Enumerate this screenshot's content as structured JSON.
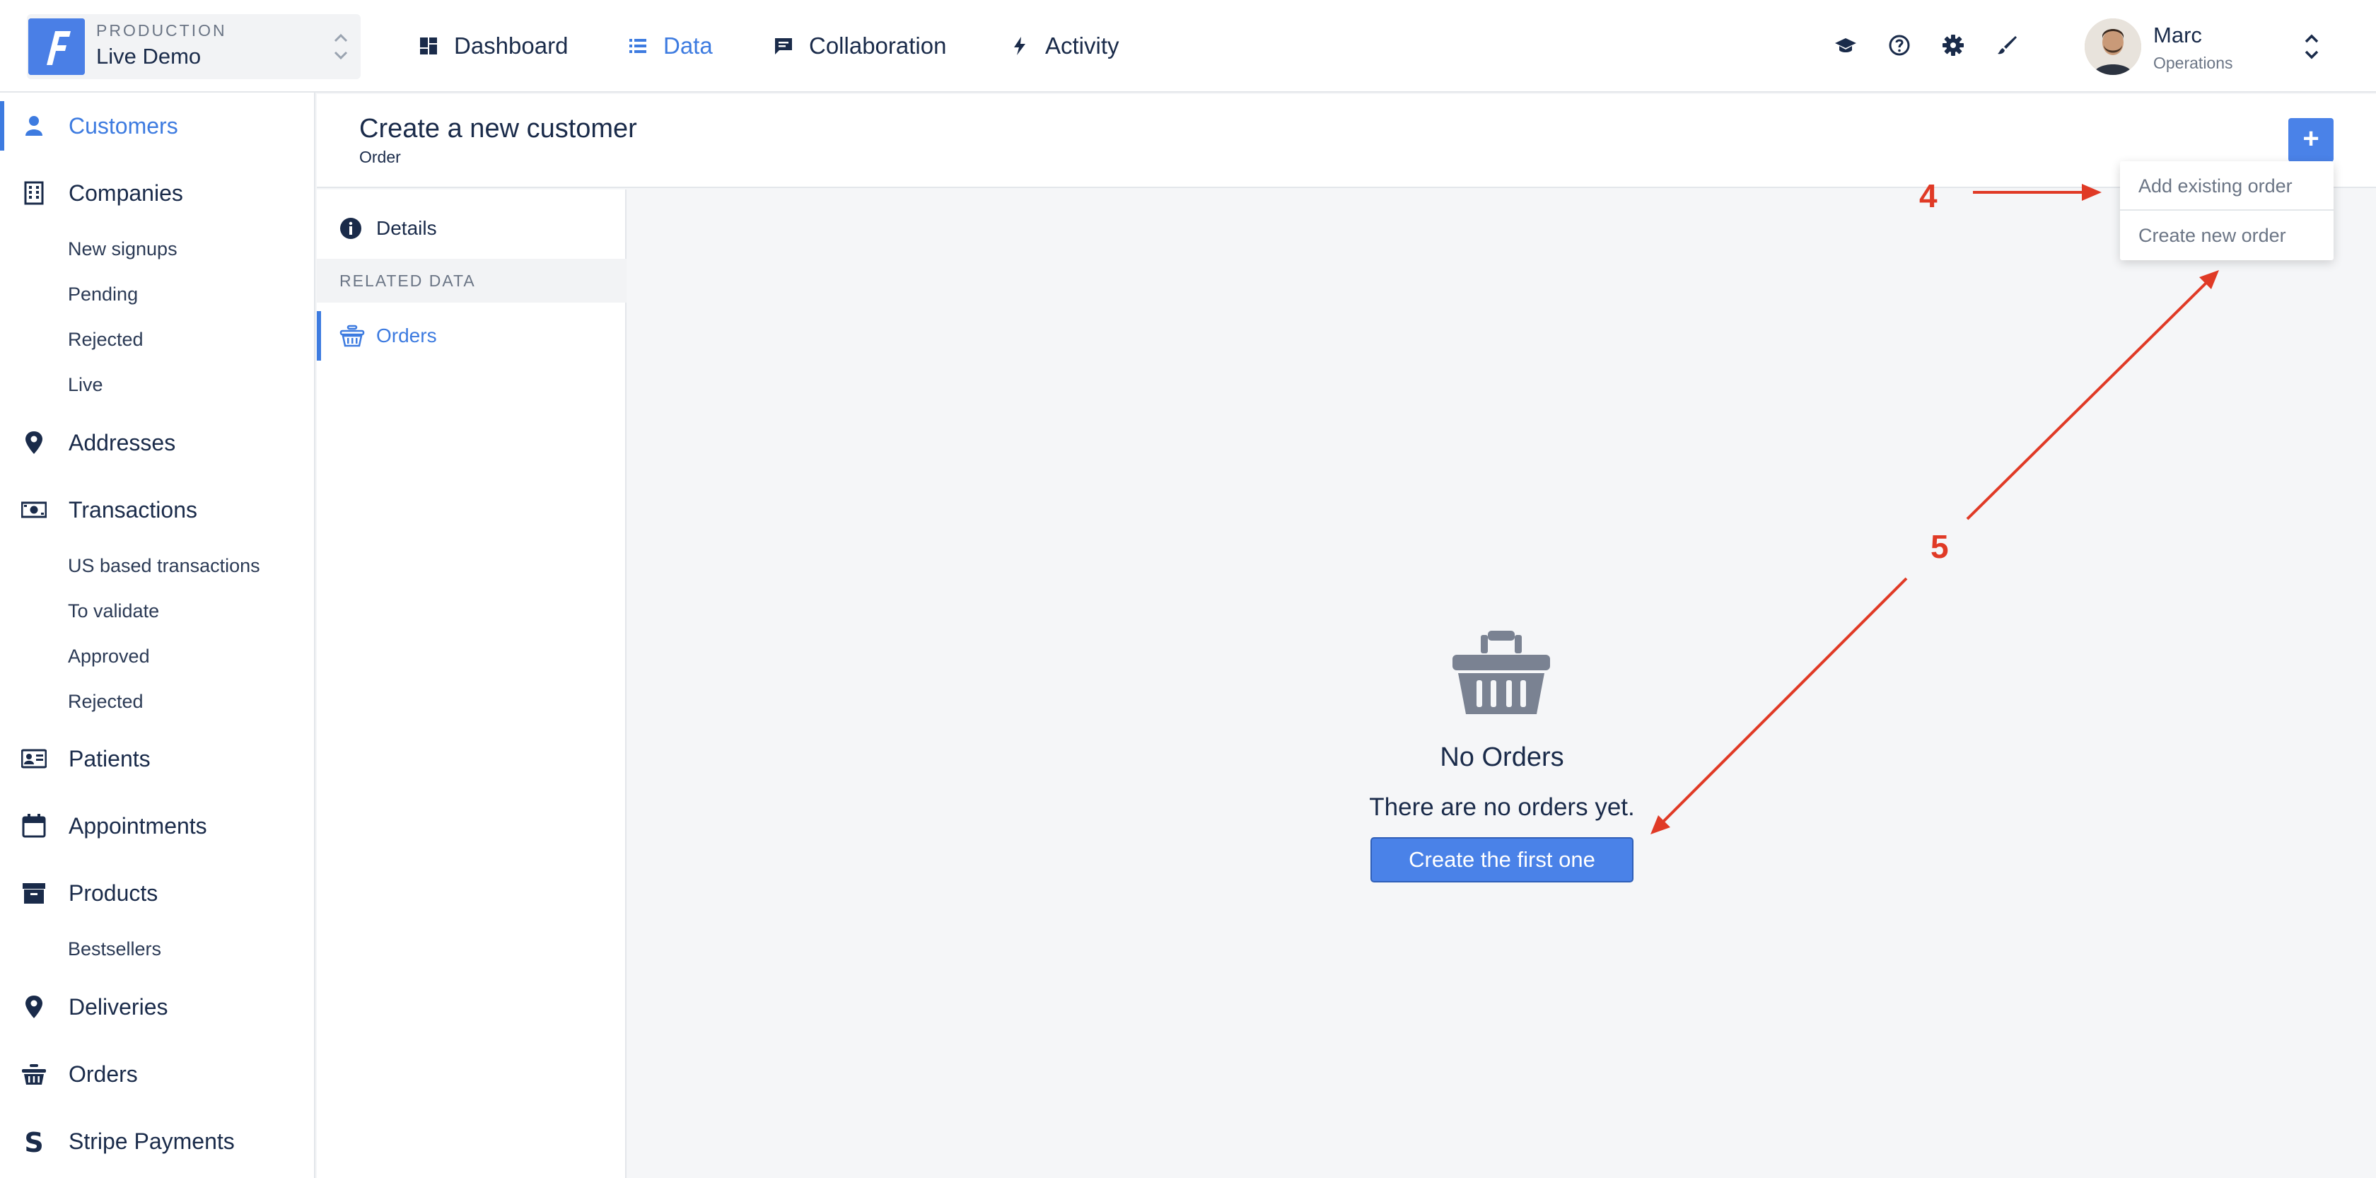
{
  "environment": {
    "label": "PRODUCTION",
    "name": "Live Demo"
  },
  "topnav": [
    {
      "label": "Dashboard",
      "icon": "dashboard-icon"
    },
    {
      "label": "Data",
      "icon": "list-icon",
      "active": true
    },
    {
      "label": "Collaboration",
      "icon": "chat-icon"
    },
    {
      "label": "Activity",
      "icon": "bolt-icon"
    }
  ],
  "tools": [
    "graduation-cap-icon",
    "help-icon",
    "gear-icon",
    "brush-icon"
  ],
  "user": {
    "name": "Marc",
    "role": "Operations"
  },
  "sidebar": {
    "customers": "Customers",
    "companies": "Companies",
    "companies_sub": [
      "New signups",
      "Pending",
      "Rejected",
      "Live"
    ],
    "addresses": "Addresses",
    "transactions": "Transactions",
    "transactions_sub": [
      "US based transactions",
      "To validate",
      "Approved",
      "Rejected"
    ],
    "patients": "Patients",
    "appointments": "Appointments",
    "products": "Products",
    "products_sub": [
      "Bestsellers"
    ],
    "deliveries": "Deliveries",
    "orders": "Orders",
    "stripe": "Stripe Payments"
  },
  "page": {
    "title": "Create a new customer",
    "subtitle": "Order",
    "add_button": "+"
  },
  "subnav": {
    "details": "Details",
    "section": "RELATED DATA",
    "orders": "Orders"
  },
  "empty_state": {
    "title": "No Orders",
    "description": "There are no orders yet.",
    "button": "Create the first one"
  },
  "dropdown": {
    "items": [
      "Add existing order",
      "Create new order"
    ]
  },
  "annotations": {
    "step4": "4",
    "step5": "5",
    "color": "#e03a26"
  },
  "colors": {
    "accent": "#3d7be0",
    "button": "#4a82e8",
    "text": "#1a2b4a",
    "muted": "#6b7585"
  }
}
